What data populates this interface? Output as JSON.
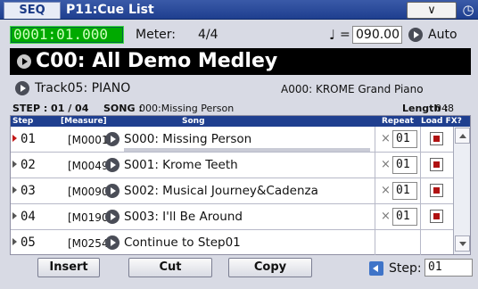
{
  "header": {
    "mode": "SEQ",
    "page_title": "P11:Cue List",
    "menu_glyph": "∨",
    "clock_glyph": "◷"
  },
  "transport": {
    "location": "0001:01.000",
    "meter_label": "Meter:",
    "meter_value": "4/4",
    "note_glyph": "♩",
    "tempo_eq": "=",
    "tempo": "090.00",
    "auto_label": "Auto"
  },
  "cue": {
    "name": "C00: All Demo Medley",
    "track": "Track05: PIANO",
    "program": "A000: KROME Grand Piano"
  },
  "info": {
    "step": "STEP : 01 / 04",
    "song_label": "SONG :",
    "song_info": "000:Missing Person",
    "length_label": "Length :",
    "length_value": "048"
  },
  "columns": {
    "step": "Step",
    "measure": "[Measure]",
    "song": "Song",
    "repeat": "Repeat",
    "load_fx": "Load FX?"
  },
  "rows": [
    {
      "step": "01",
      "measure": "[M0001]",
      "song": "S000: Missing Person",
      "times": "×",
      "repeat": "01",
      "load_fx": true,
      "active": true
    },
    {
      "step": "02",
      "measure": "[M0049]",
      "song": "S001: Krome Teeth",
      "times": "×",
      "repeat": "01",
      "load_fx": true,
      "active": false
    },
    {
      "step": "03",
      "measure": "[M0090]",
      "song": "S002: Musical Journey&Cadenza",
      "times": "×",
      "repeat": "01",
      "load_fx": true,
      "active": false
    },
    {
      "step": "04",
      "measure": "[M0190]",
      "song": "S003: I'll Be Around",
      "times": "×",
      "repeat": "01",
      "load_fx": true,
      "active": false
    },
    {
      "step": "05",
      "measure": "[M0254]",
      "song": "Continue to Step01",
      "times": "",
      "repeat": "",
      "load_fx": false,
      "active": false
    }
  ],
  "buttons": {
    "insert": "Insert",
    "cut": "Cut",
    "copy": "Copy",
    "step_label": "Step:",
    "step_value": "01"
  },
  "colors": {
    "title_bar": "#1f3f8f",
    "location_bg": "#00aa00",
    "cue_bar": "#000000",
    "load_fx_on": "#b01212",
    "active_caret": "#c31818"
  }
}
